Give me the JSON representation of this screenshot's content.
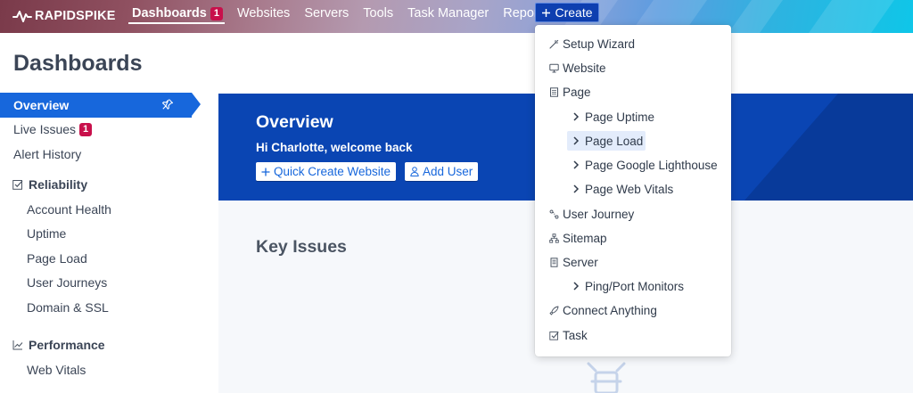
{
  "brand": {
    "logo_text": "RAPIDSPIKE"
  },
  "nav": {
    "items": [
      {
        "label": "Dashboards",
        "badge": "1",
        "active": true
      },
      {
        "label": "Websites"
      },
      {
        "label": "Servers"
      },
      {
        "label": "Tools"
      },
      {
        "label": "Task Manager"
      },
      {
        "label": "Reports"
      }
    ],
    "create_label": "Create"
  },
  "page": {
    "title": "Dashboards"
  },
  "sidebar": {
    "items": [
      {
        "label": "Overview",
        "active": true
      },
      {
        "label": "Live Issues",
        "badge": "1"
      },
      {
        "label": "Alert History"
      }
    ],
    "sections": [
      {
        "label": "Reliability",
        "icon": "check-square-icon",
        "items": [
          "Account Health",
          "Uptime",
          "Page Load",
          "User Journeys",
          "Domain & SSL"
        ]
      },
      {
        "label": "Performance",
        "icon": "chart-icon",
        "items": [
          "Web Vitals"
        ]
      }
    ]
  },
  "overview": {
    "title": "Overview",
    "greeting": "Hi Charlotte, welcome back",
    "buttons": {
      "quick_create": "Quick Create Website",
      "add_user": "Add User"
    }
  },
  "key_issues": {
    "title": "Key Issues"
  },
  "create_menu": {
    "items": [
      {
        "label": "Setup Wizard",
        "icon": "wand-icon"
      },
      {
        "label": "Website",
        "icon": "monitor-icon"
      },
      {
        "label": "Page",
        "icon": "page-icon"
      },
      {
        "label": "Page Uptime",
        "sub": true
      },
      {
        "label": "Page Load",
        "sub": true,
        "highlighted": true
      },
      {
        "label": "Page Google Lighthouse",
        "sub": true
      },
      {
        "label": "Page Web Vitals",
        "sub": true
      },
      {
        "label": "User Journey",
        "icon": "journey-icon"
      },
      {
        "label": "Sitemap",
        "icon": "sitemap-icon"
      },
      {
        "label": "Server",
        "icon": "server-icon"
      },
      {
        "label": "Ping/Port Monitors",
        "sub": true
      },
      {
        "label": "Connect Anything",
        "icon": "rocket-icon"
      },
      {
        "label": "Task",
        "icon": "task-icon"
      }
    ]
  },
  "colors": {
    "accent": "#1767dc",
    "nav_create": "#0e3fb0",
    "badge": "#c8104b",
    "overview_band": "#0a45b3"
  }
}
